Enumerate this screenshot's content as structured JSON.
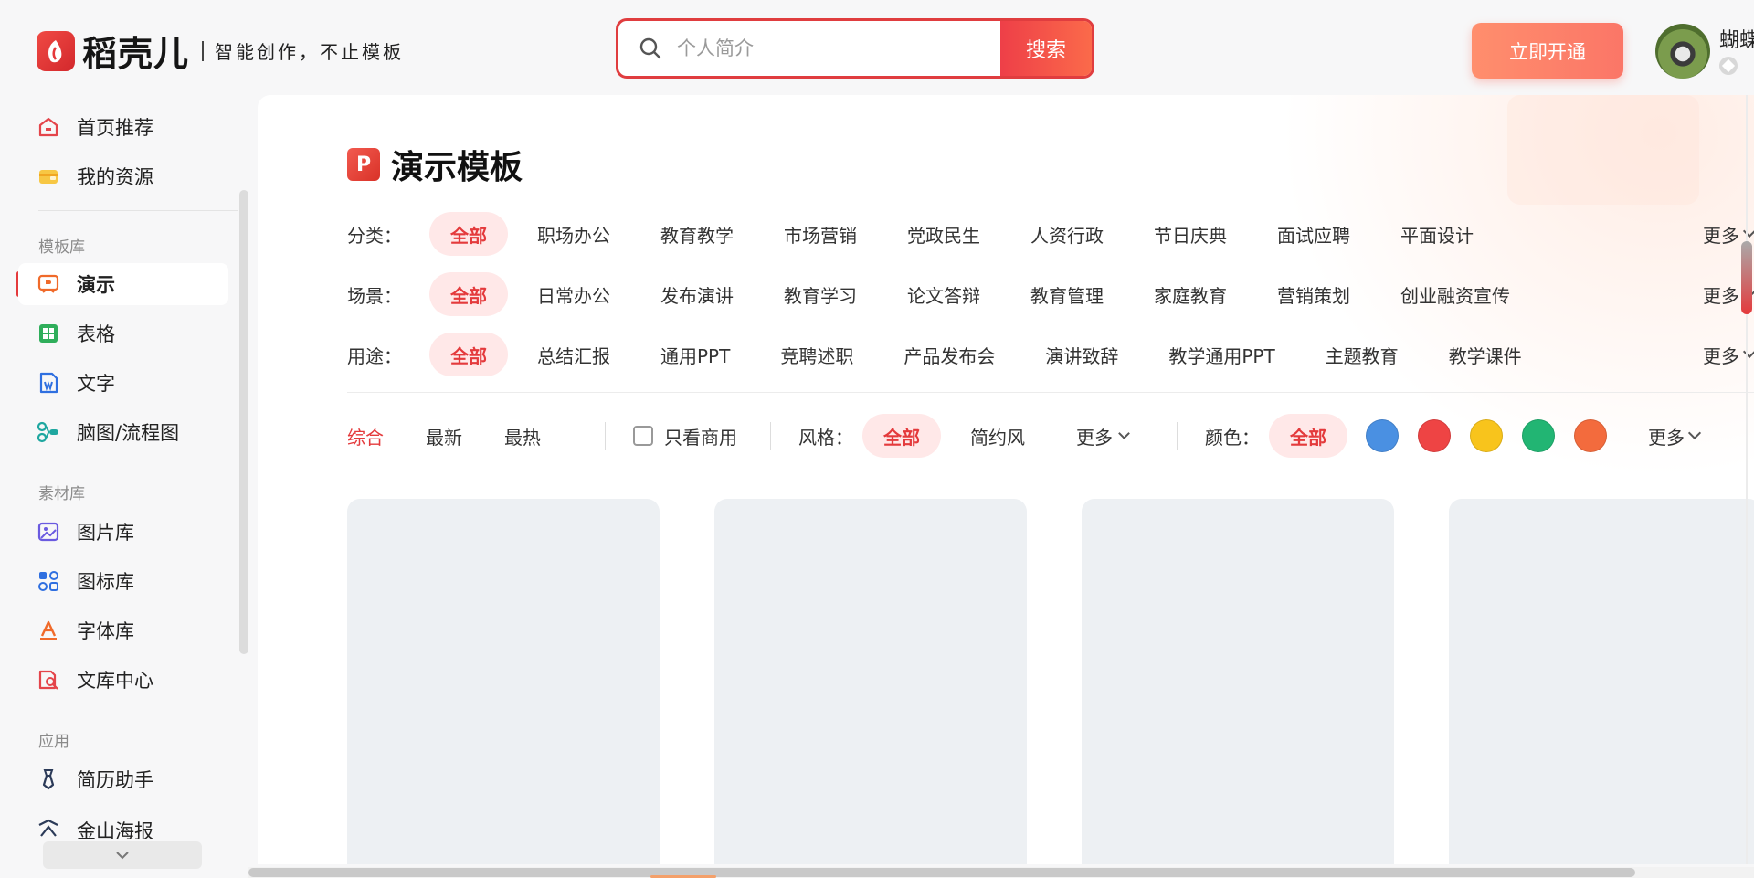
{
  "brand": {
    "name": "稻壳儿",
    "slogan": "智能创作，不止模板"
  },
  "search": {
    "placeholder": "个人简介",
    "button": "搜索"
  },
  "header": {
    "vip_button": "立即开通",
    "username": "蝴蝶"
  },
  "sidebar": {
    "top_items": [
      {
        "label": "首页推荐",
        "icon": "home-icon"
      },
      {
        "label": "我的资源",
        "icon": "wallet-icon"
      }
    ],
    "groups": [
      {
        "title": "模板库",
        "items": [
          {
            "label": "演示",
            "icon": "presentation-icon",
            "active": true
          },
          {
            "label": "表格",
            "icon": "spreadsheet-icon"
          },
          {
            "label": "文字",
            "icon": "document-icon"
          },
          {
            "label": "脑图/流程图",
            "icon": "mindmap-icon"
          }
        ]
      },
      {
        "title": "素材库",
        "items": [
          {
            "label": "图片库",
            "icon": "image-icon"
          },
          {
            "label": "图标库",
            "icon": "icon-grid-icon"
          },
          {
            "label": "字体库",
            "icon": "font-icon"
          },
          {
            "label": "文库中心",
            "icon": "library-icon"
          }
        ]
      },
      {
        "title": "应用",
        "items": [
          {
            "label": "简历助手",
            "icon": "resume-icon"
          },
          {
            "label": "金山海报",
            "icon": "poster-icon"
          }
        ]
      }
    ]
  },
  "main": {
    "title": "演示模板",
    "filters": [
      {
        "label": "分类：",
        "options": [
          "全部",
          "职场办公",
          "教育教学",
          "市场营销",
          "党政民生",
          "人资行政",
          "节日庆典",
          "面试应聘",
          "平面设计"
        ],
        "selected": "全部",
        "more": "更多"
      },
      {
        "label": "场景：",
        "options": [
          "全部",
          "日常办公",
          "发布演讲",
          "教育学习",
          "论文答辩",
          "教育管理",
          "家庭教育",
          "营销策划",
          "创业融资宣传"
        ],
        "selected": "全部",
        "more": "更多"
      },
      {
        "label": "用途：",
        "options": [
          "全部",
          "总结汇报",
          "通用PPT",
          "竞聘述职",
          "产品发布会",
          "演讲致辞",
          "教学通用PPT",
          "主题教育",
          "教学课件"
        ],
        "selected": "全部",
        "more": "更多"
      }
    ],
    "sort_tabs": [
      "综合",
      "最新",
      "最热"
    ],
    "sort_selected": "综合",
    "commercial_only": "只看商用",
    "style": {
      "label": "风格：",
      "options": [
        "全部",
        "简约风"
      ],
      "selected": "全部",
      "more": "更多"
    },
    "color": {
      "label": "颜色：",
      "all": "全部",
      "swatches": [
        "#4a90e2",
        "#ee4444",
        "#f8c41c",
        "#22b573",
        "#f36b3d"
      ],
      "more": "更多"
    },
    "card_count": 4
  }
}
